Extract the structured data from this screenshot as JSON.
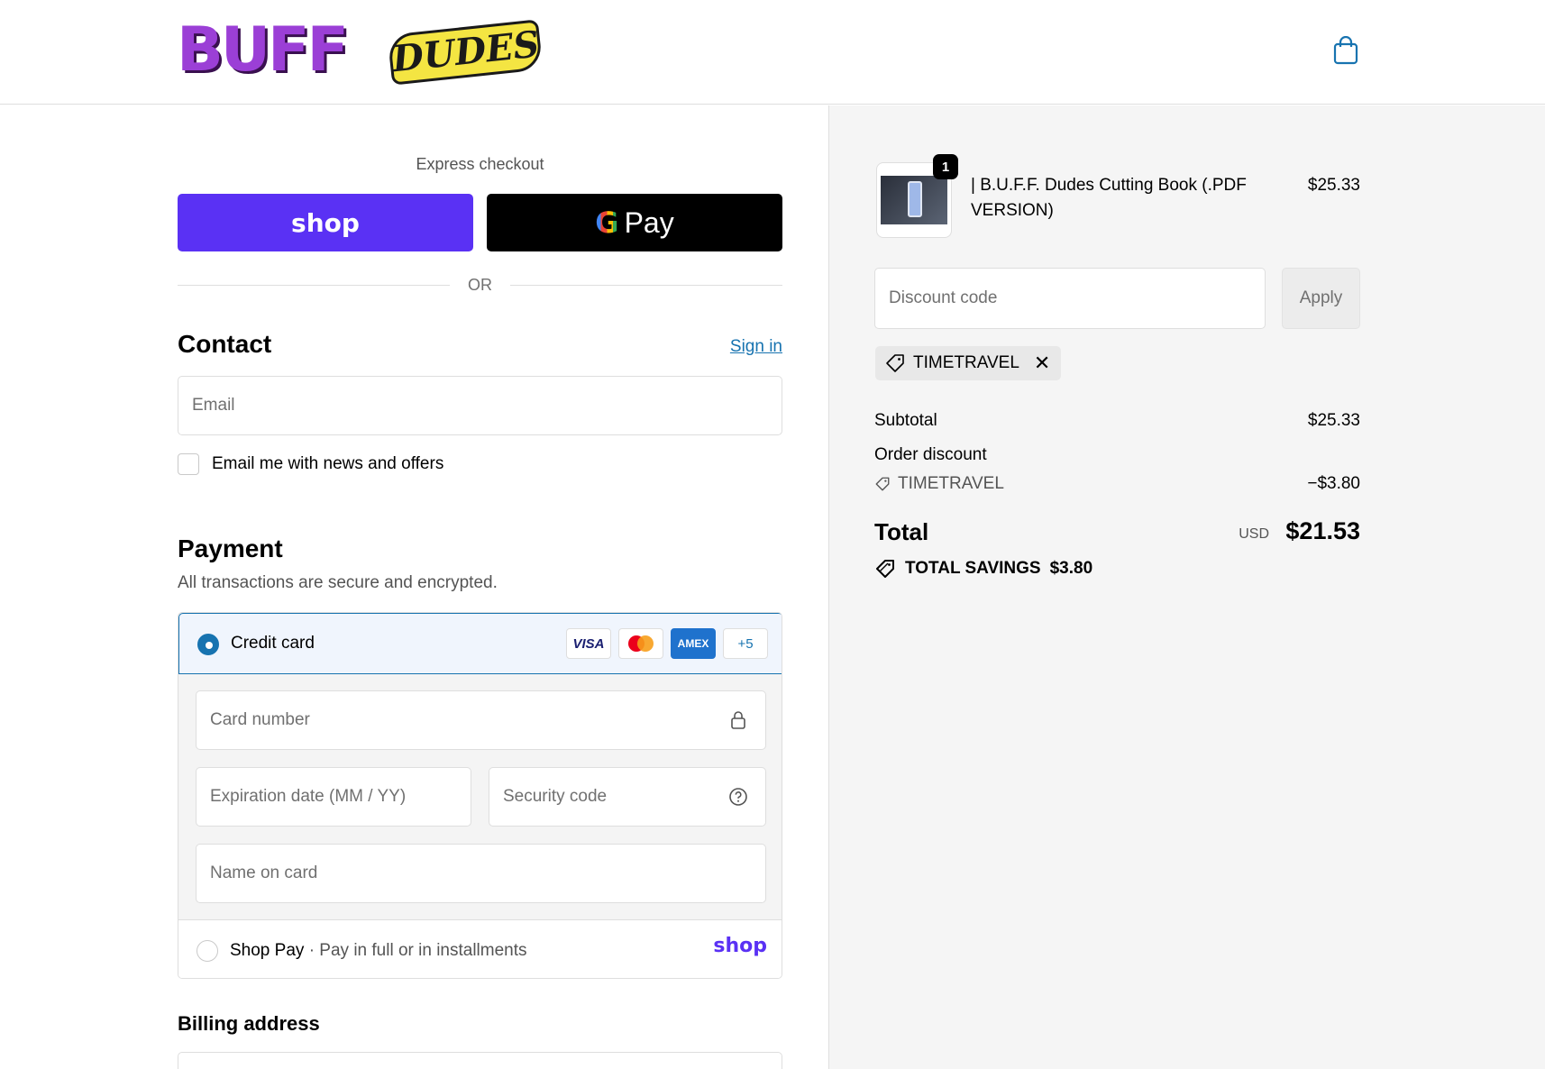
{
  "brand": {
    "logo_text_main": "BUFF",
    "logo_text_secondary": "DUDES"
  },
  "header": {
    "cart_icon": "shopping-bag-icon"
  },
  "express": {
    "title": "Express checkout",
    "shop_pay_label": "shop",
    "gpay_label": "Pay",
    "gpay_g": "G",
    "separator": "OR"
  },
  "contact": {
    "title": "Contact",
    "sign_in": "Sign in",
    "email_placeholder": "Email",
    "newsletter_label": "Email me with news and offers"
  },
  "payment": {
    "title": "Payment",
    "subtitle": "All transactions are secure and encrypted.",
    "credit_card_label": "Credit card",
    "brands": [
      "VISA",
      "MC",
      "AMEX",
      "+5"
    ],
    "card_number_placeholder": "Card number",
    "expiration_placeholder": "Expiration date (MM / YY)",
    "security_code_placeholder": "Security code",
    "name_on_card_placeholder": "Name on card",
    "shop_pay_label": "Shop Pay",
    "shop_pay_sub": "Pay in full or in installments",
    "shop_pay_logo": "shop"
  },
  "billing": {
    "title": "Billing address"
  },
  "summary": {
    "product": {
      "quantity": "1",
      "name": "| B.U.F.F. Dudes Cutting Book (.PDF VERSION)",
      "price": "$25.33"
    },
    "discount_placeholder": "Discount code",
    "apply_label": "Apply",
    "applied_code": "TIMETRAVEL",
    "subtotal_label": "Subtotal",
    "subtotal_value": "$25.33",
    "order_discount_label": "Order discount",
    "discount_code_label": "TIMETRAVEL",
    "discount_value": "−$3.80",
    "total_label": "Total",
    "currency": "USD",
    "total_value": "$21.53",
    "savings_label": "TOTAL SAVINGS",
    "savings_value": "$3.80"
  },
  "colors": {
    "accent": "#1773b0",
    "shop_pay": "#5a31f4",
    "brand_purple": "#9b3fd6",
    "brand_yellow": "#f4e542"
  }
}
